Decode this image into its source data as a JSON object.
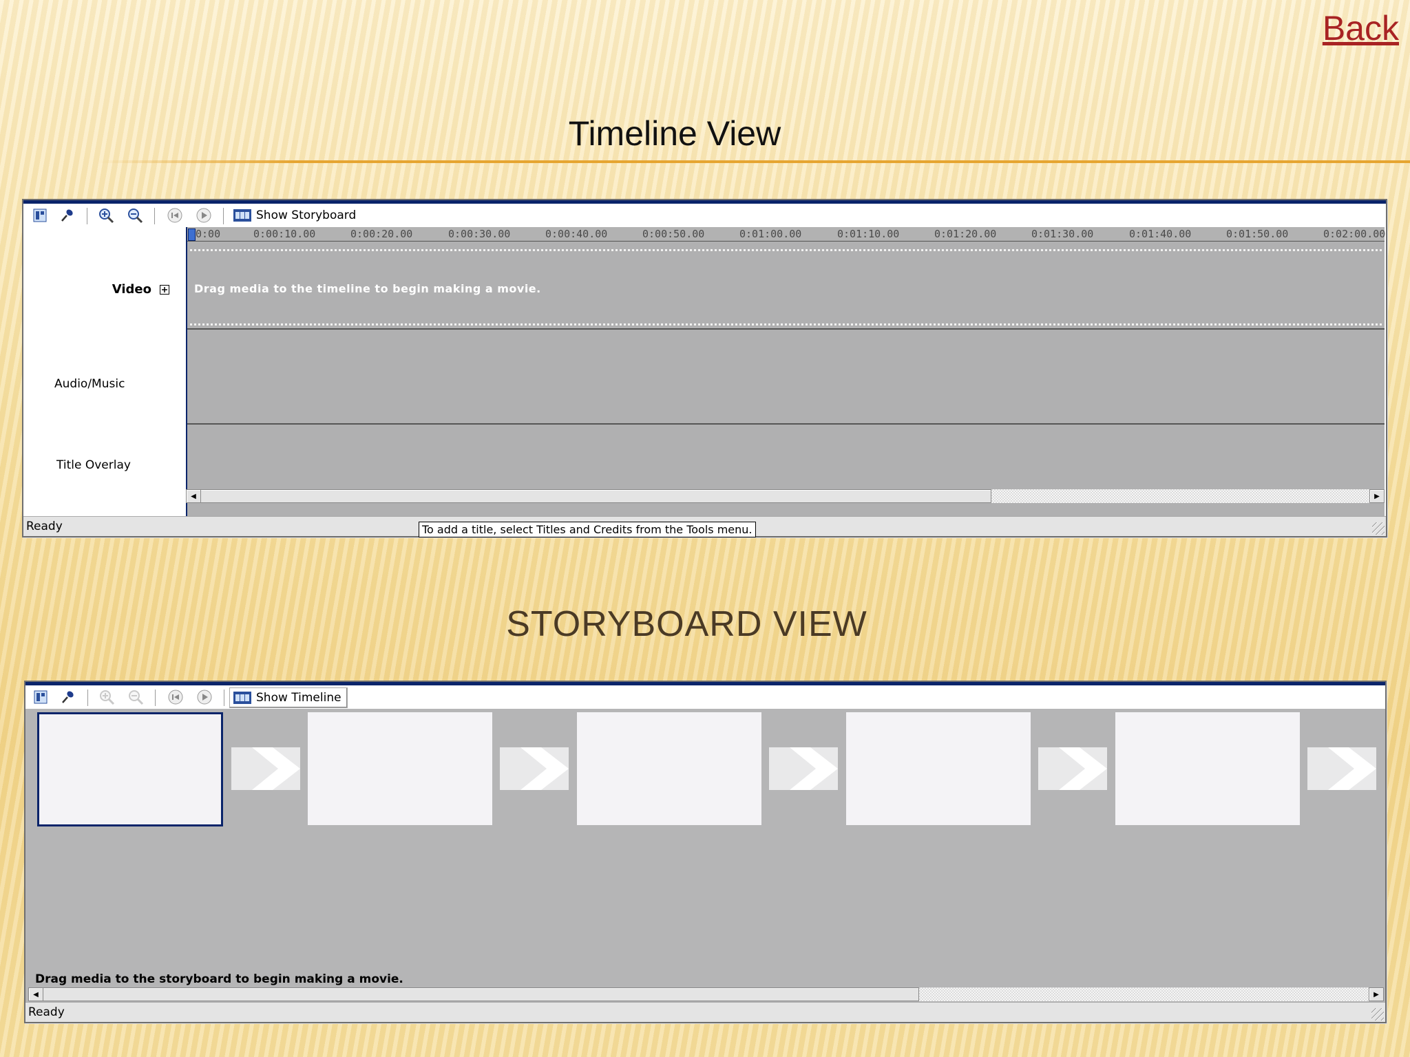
{
  "back_link": "Back",
  "timeline_heading": "Timeline View",
  "storyboard_heading": "STORYBOARD VIEW",
  "timeline_window": {
    "toolbar": {
      "toggle_label": "Show Storyboard"
    },
    "ruler_ticks": [
      "0:00",
      "0:00:10.00",
      "0:00:20.00",
      "0:00:30.00",
      "0:00:40.00",
      "0:00:50.00",
      "0:01:00.00",
      "0:01:10.00",
      "0:01:20.00",
      "0:01:30.00",
      "0:01:40.00",
      "0:01:50.00",
      "0:02:00.00"
    ],
    "tracks": {
      "video_label": "Video",
      "audio_label": "Audio/Music",
      "title_label": "Title Overlay"
    },
    "drag_message": "Drag media to the timeline to begin making a movie.",
    "tooltip": "To add a title, select Titles and Credits from the Tools menu.",
    "status": "Ready"
  },
  "storyboard_window": {
    "toolbar": {
      "toggle_label": "Show Timeline"
    },
    "drag_message": "Drag media to the storyboard to begin making a movie.",
    "status": "Ready"
  },
  "icons": [
    "storyboard-toggle-icon",
    "narrate-microphone-icon",
    "zoom-in-icon",
    "zoom-out-icon",
    "rewind-icon",
    "play-icon",
    "filmstrip-icon",
    "expand-plus-icon",
    "scroll-left-arrow-icon",
    "scroll-right-arrow-icon",
    "transition-arrow-icon",
    "resize-grip-icon"
  ],
  "colors": {
    "link": "#a82323",
    "accent_rule": "#e6a531",
    "window_title_bar": "#0a246a",
    "track_bg": "#b0b0b1"
  }
}
